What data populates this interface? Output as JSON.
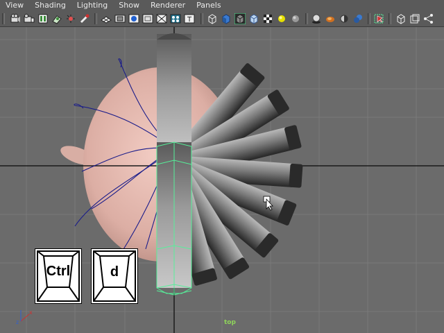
{
  "menu": {
    "items": [
      "View",
      "Shading",
      "Lighting",
      "Show",
      "Renderer",
      "Panels"
    ]
  },
  "toolbar": {
    "icons": [
      "camera-icon",
      "camera-attributes-icon",
      "bookmarks-icon",
      "image-plane-icon",
      "2d-pan-zoom-icon",
      "grease-pencil-icon",
      "grid-icon",
      "film-gate-icon",
      "resolution-gate-icon",
      "gate-mask-icon",
      "field-chart-icon",
      "safe-action-icon",
      "safe-title-icon",
      "wireframe-icon",
      "smooth-shade-icon",
      "wireframe-on-shaded-icon",
      "default-material-icon",
      "xray-icon",
      "use-default-lighting-icon",
      "all-lights-icon",
      "shadows-icon",
      "screen-space-ao-icon",
      "motion-blur-icon",
      "anti-aliasing-icon",
      "isolate-select-icon",
      "xray-joints-icon",
      "xray-components-icon",
      "symmetry-icon"
    ]
  },
  "viewport": {
    "camera_label": "top",
    "axis_labels": {
      "x": "x",
      "z": "z"
    }
  },
  "key_overlay": {
    "key1": "Ctrl",
    "key2": "d"
  },
  "colors": {
    "viewport_bg": "#6b6b6b",
    "grid_line": "#7a7a7a",
    "axis_line": "#1a1a1a",
    "selection_green": "#56f09a",
    "curve_blue": "#1a1c8a",
    "head_skin": "#e2b6ad"
  }
}
